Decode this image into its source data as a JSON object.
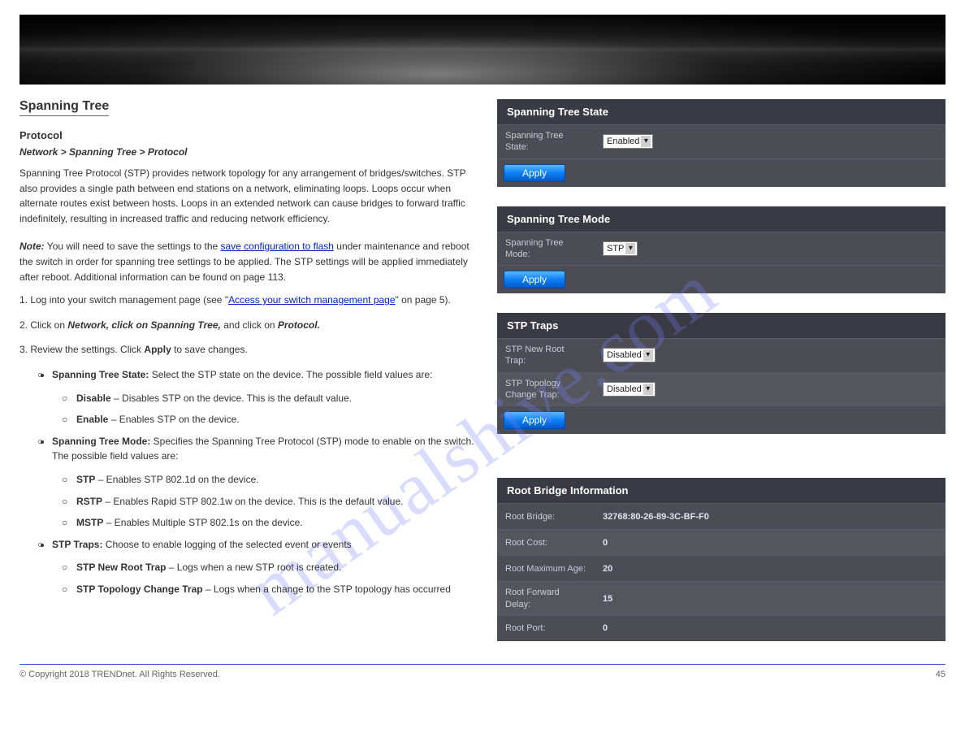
{
  "header": {
    "section_title": "Spanning Tree",
    "protocol_heading": "Protocol",
    "path": "Network > Spanning Tree > Protocol",
    "intro_para": "Spanning Tree Protocol (STP) provides network topology for any arrangement of bridges/switches. STP also provides a single path between end stations on a network, eliminating loops. Loops occur when alternate routes exist between hosts. Loops in an extended network can cause bridges to forward traffic indefinitely, resulting in increased traffic and reducing network efficiency.",
    "note_label": "Note:",
    "note_text_1": "You will need to save the settings to the ",
    "note_text_2": " under maintenance and reboot the switch in order for spanning tree settings to be applied. The STP settings will be applied immediately after reboot. Additional information can be found on page ",
    "note_link_text": "save configuration to flash",
    "note_end": "113.",
    "step1_pre": "1.  Log into your switch management page (see \"",
    "step1_link": "Access your switch management page",
    "step1_post": "\" on page 5).",
    "step2_text": "2.  Click on ",
    "step2_path": "Network, click on Spanning Tree,",
    "step2_text2": " and click on ",
    "step2_path2": "Protocol.",
    "step3_text": "3.  Review the settings. Click ",
    "step3_bold": "Apply",
    "step3_text2": " to save changes."
  },
  "bullets": {
    "b1_label": "Spanning Tree State:",
    "b1_text": " Select the STP state on the device. The possible field values are:",
    "b1a_label": "Disable",
    "b1a_text": " – Disables STP on the device. This is the default value.",
    "b1b_label": "Enable",
    "b1b_text": " – Enables STP on the device.",
    "b2_label": "Spanning Tree Mode:",
    "b2_text": " Specifies the Spanning Tree Protocol (STP) mode to enable on the switch. The possible field values are:",
    "b2a_label": "STP",
    "b2a_text": " – Enables STP 802.1d on the device.",
    "b2b_label": "RSTP",
    "b2b_text": " – Enables Rapid STP 802.1w on the device. This is the default value.",
    "b2c_label": "MSTP",
    "b2c_text": " – Enables Multiple STP 802.1s on the device.",
    "b3_label": "STP Traps:",
    "b3_text": " Choose to enable logging of the selected event or events",
    "b3a_label": "STP New Root Trap",
    "b3a_text": " – Logs when a new STP root is created.",
    "b3b_label": "STP Topology Change Trap",
    "b3b_text": " – Logs when a change to the STP topology has occurred"
  },
  "panel": {
    "state_title": "Spanning Tree State",
    "state_label": "Spanning Tree State:",
    "state_value": "Enabled",
    "mode_title": "Spanning Tree Mode",
    "mode_label": "Spanning Tree Mode:",
    "mode_value": "STP",
    "traps_title": "STP Traps",
    "trap_root_label": "STP New Root Trap:",
    "trap_root_value": "Disabled",
    "trap_topo_label": "STP Topology Change Trap:",
    "trap_topo_value": "Disabled",
    "apply_label": "Apply"
  },
  "rootbridge": {
    "title": "Root Bridge Information",
    "rows": [
      {
        "label": "Root Bridge:",
        "value": "32768:80-26-89-3C-BF-F0"
      },
      {
        "label": "Root Cost:",
        "value": "0"
      },
      {
        "label": "Root Maximum Age:",
        "value": "20"
      },
      {
        "label": "Root Forward Delay:",
        "value": "15"
      },
      {
        "label": "Root Port:",
        "value": "0"
      }
    ]
  },
  "footer": {
    "left": "© Copyright 2018 TRENDnet. All Rights Reserved.",
    "right": "45"
  },
  "watermark": "manualshive.com"
}
